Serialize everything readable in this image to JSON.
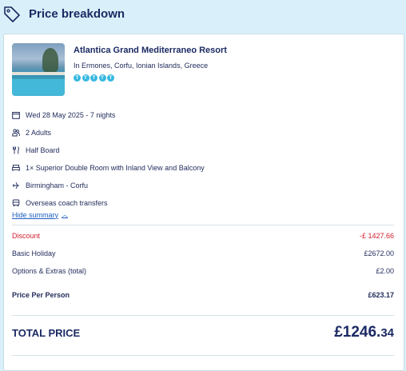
{
  "header": {
    "title": "Price breakdown",
    "icon": "tag-icon"
  },
  "hotel": {
    "name": "Atlantica Grand Mediterraneo Resort",
    "location": "In Ermones, Corfu, Ionian Islands, Greece",
    "rating": 5,
    "rating_glyph": "T"
  },
  "details": [
    {
      "icon": "calendar-icon",
      "text": "Wed 28 May 2025 - 7 nights"
    },
    {
      "icon": "people-icon",
      "text": "2 Adults"
    },
    {
      "icon": "cutlery-icon",
      "text": "Half Board"
    },
    {
      "icon": "bed-icon",
      "text": "1× Superior Double Room with Inland View and Balcony"
    },
    {
      "icon": "plane-icon",
      "text": "Birmingham - Corfu"
    },
    {
      "icon": "coach-icon",
      "text": "Overseas coach transfers"
    }
  ],
  "summary_toggle": "Hide summary",
  "prices": {
    "discount": {
      "label": "Discount",
      "value": "-£ 1427.66"
    },
    "basic": {
      "label": "Basic Holiday",
      "value": "£2672.00"
    },
    "extras": {
      "label": "Options & Extras (total)",
      "value": "£2.00"
    },
    "per_person": {
      "label": "Price Per Person",
      "value": "£623.17"
    }
  },
  "total": {
    "label": "TOTAL PRICE",
    "pounds": "£1246.",
    "pence": "34"
  },
  "colors": {
    "accent": "#1b2a63",
    "discount": "#d0202f",
    "link": "#1f5fc1",
    "star": "#37b8e0",
    "background": "#d9f0fa"
  }
}
